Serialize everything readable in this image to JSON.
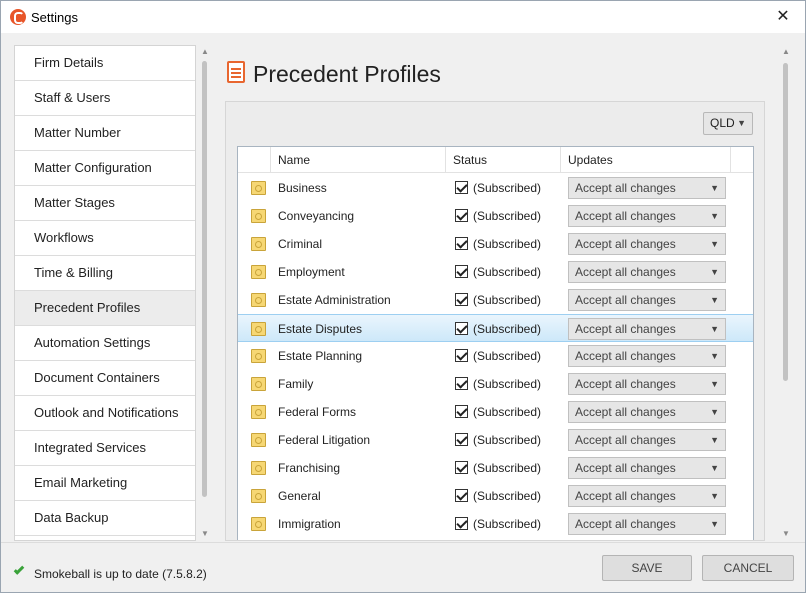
{
  "window": {
    "title": "Settings",
    "close_glyph": "✕"
  },
  "sidebar": {
    "items": [
      {
        "label": "Firm Details"
      },
      {
        "label": "Staff & Users"
      },
      {
        "label": "Matter Number"
      },
      {
        "label": "Matter Configuration"
      },
      {
        "label": "Matter Stages"
      },
      {
        "label": "Workflows"
      },
      {
        "label": "Time & Billing"
      },
      {
        "label": "Precedent Profiles",
        "selected": true
      },
      {
        "label": "Automation Settings"
      },
      {
        "label": "Document Containers"
      },
      {
        "label": "Outlook and Notifications"
      },
      {
        "label": "Integrated Services"
      },
      {
        "label": "Email Marketing"
      },
      {
        "label": "Data Backup"
      }
    ],
    "scroll_up": "▲",
    "scroll_down": "▼"
  },
  "main": {
    "title": "Precedent Profiles",
    "state_select": {
      "value": "QLD",
      "chevron": "▼"
    },
    "table": {
      "columns": [
        "Name",
        "Status",
        "Updates"
      ],
      "rows": [
        {
          "name": "Business",
          "status": "(Subscribed)",
          "checked": true,
          "update": "Accept all changes"
        },
        {
          "name": "Conveyancing",
          "status": "(Subscribed)",
          "checked": true,
          "update": "Accept all changes"
        },
        {
          "name": "Criminal",
          "status": "(Subscribed)",
          "checked": true,
          "update": "Accept all changes"
        },
        {
          "name": "Employment",
          "status": "(Subscribed)",
          "checked": true,
          "update": "Accept all changes"
        },
        {
          "name": "Estate Administration",
          "status": "(Subscribed)",
          "checked": true,
          "update": "Accept all changes"
        },
        {
          "name": "Estate Disputes",
          "status": "(Subscribed)",
          "checked": true,
          "update": "Accept all changes",
          "selected": true
        },
        {
          "name": "Estate Planning",
          "status": "(Subscribed)",
          "checked": true,
          "update": "Accept all changes"
        },
        {
          "name": "Family",
          "status": "(Subscribed)",
          "checked": true,
          "update": "Accept all changes"
        },
        {
          "name": "Federal Forms",
          "status": "(Subscribed)",
          "checked": true,
          "update": "Accept all changes"
        },
        {
          "name": "Federal Litigation",
          "status": "(Subscribed)",
          "checked": true,
          "update": "Accept all changes"
        },
        {
          "name": "Franchising",
          "status": "(Subscribed)",
          "checked": true,
          "update": "Accept all changes"
        },
        {
          "name": "General",
          "status": "(Subscribed)",
          "checked": true,
          "update": "Accept all changes"
        },
        {
          "name": "Immigration",
          "status": "(Subscribed)",
          "checked": true,
          "update": "Accept all changes"
        }
      ]
    },
    "scroll_up": "▲",
    "scroll_down": "▼"
  },
  "footer": {
    "status_text": "Smokeball is up to date (7.5.8.2)",
    "save_label": "SAVE",
    "cancel_label": "CANCEL"
  },
  "colors": {
    "accent": "#e8662f",
    "status_ok": "#3aa23a",
    "selection": "#cde8f9"
  },
  "icons": {
    "app": "smokeball-logo-icon",
    "header": "document-icon",
    "row": "folder-icon",
    "status": "checkmark-icon"
  }
}
